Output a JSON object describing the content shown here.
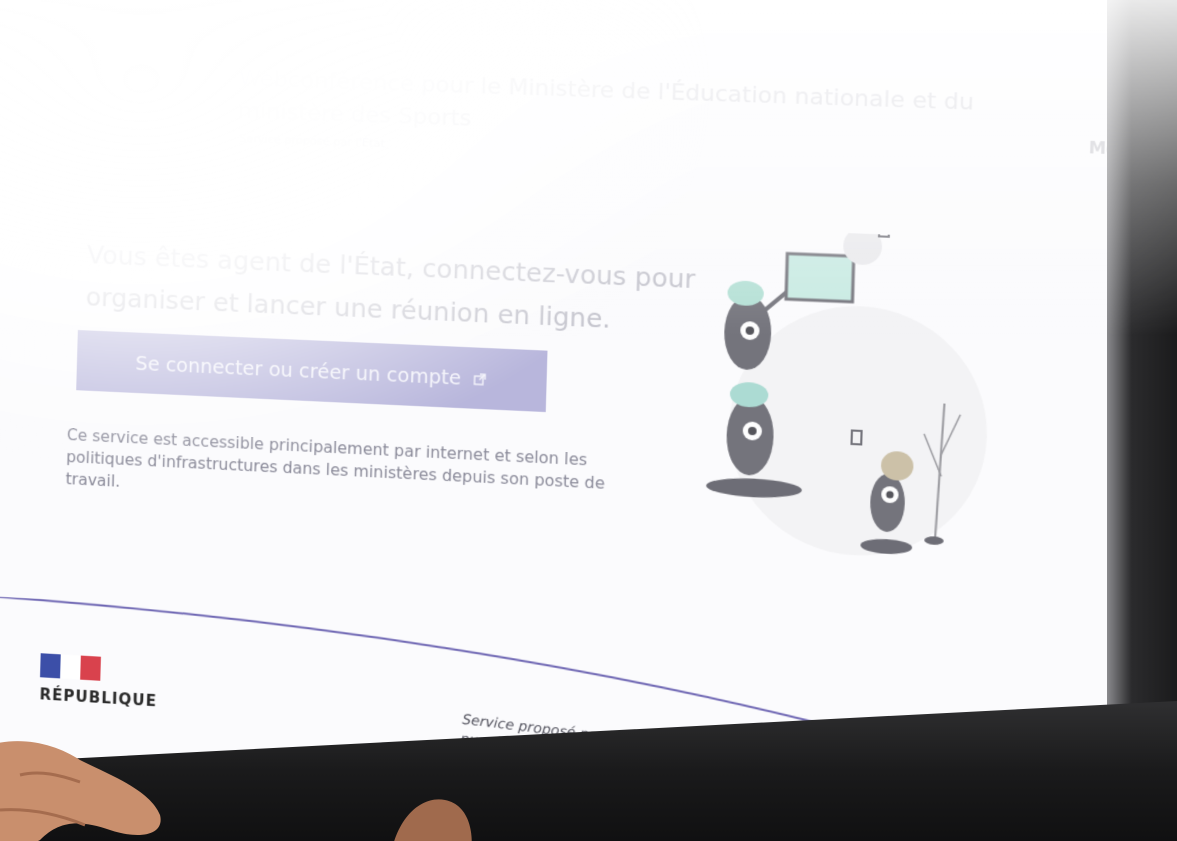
{
  "header": {
    "title": "Webconférence pour le Ministère de l'Éducation nationale et du ministère des Sports",
    "subtitle": "Service proposé par l'État",
    "right_link": "Menu"
  },
  "main": {
    "heading": "Vous êtes agent de l'État, connectez-vous pour organiser et lancer une réunion en ligne.",
    "cta_label": "Se connecter ou créer un compte",
    "info": "Ce service est accessible principalement par internet et selon les politiques d'infrastructures dans les ministères depuis son poste de travail."
  },
  "footer": {
    "brand": "RÉPUBLIQUE",
    "credit": "Service proposé par la Direction interministérielle du numérique et la Direction du numérique pour l'éducation"
  },
  "colors": {
    "cta_background": "#b8b6dc",
    "footer_line": "#6e66b3",
    "flag_blue": "#3c4fa8",
    "flag_red": "#d9424d"
  },
  "icons": {
    "cta": "external-link-icon",
    "illustration": "monster-characters-illustration"
  }
}
